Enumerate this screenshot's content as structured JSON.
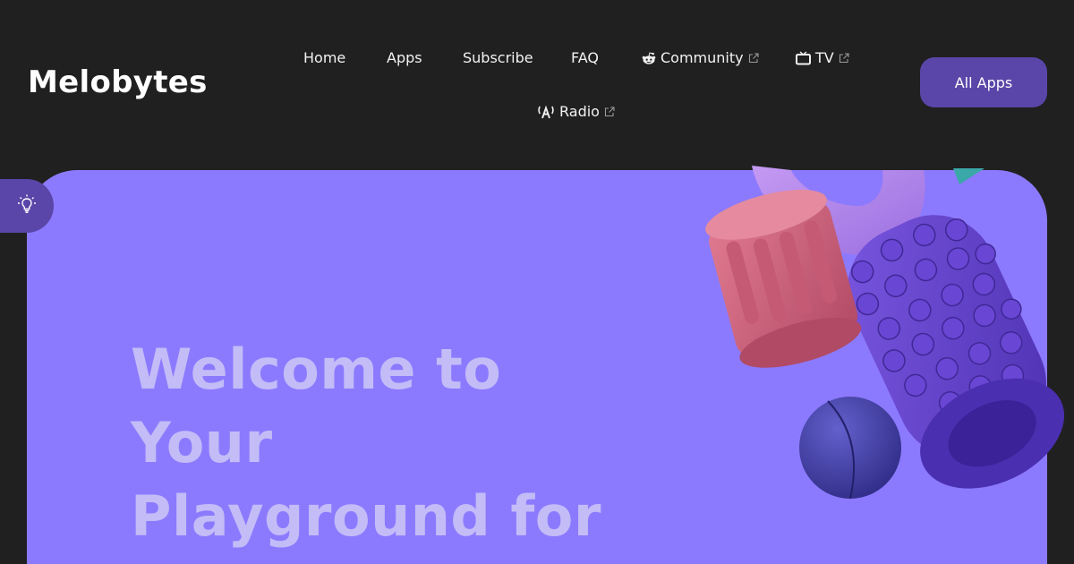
{
  "brand": "Melobytes",
  "nav": {
    "home": "Home",
    "apps": "Apps",
    "subscribe": "Subscribe",
    "faq": "FAQ",
    "community": "Community",
    "tv": "TV",
    "radio": "Radio"
  },
  "all_apps": "All Apps",
  "hero": {
    "line1": "Welcome to",
    "line2": "Your",
    "line3": "Playground for"
  },
  "icons": {
    "community": "reddit-icon",
    "tv": "tv-icon",
    "radio": "radio-tower-icon",
    "external": "external-link-icon",
    "tip": "lightbulb-icon"
  },
  "colors": {
    "background": "#202020",
    "accent": "#5a46a8",
    "hero": "#8c7afe",
    "hero_text": "#c4bcf7"
  }
}
